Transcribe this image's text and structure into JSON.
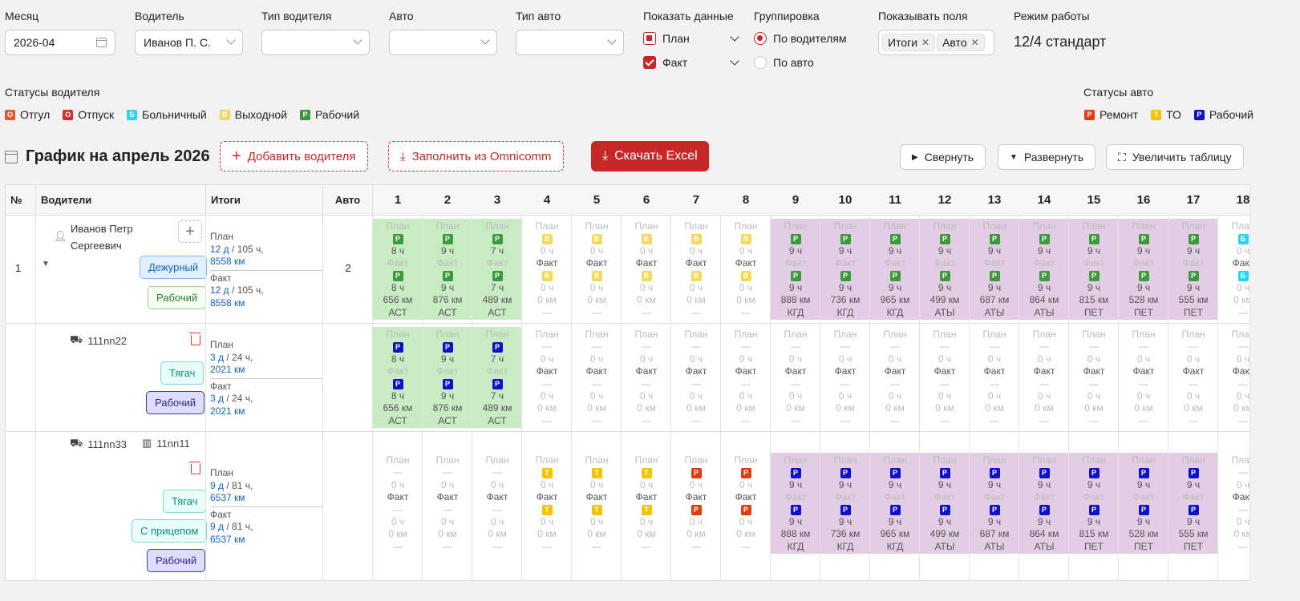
{
  "filters": {
    "month": {
      "label": "Месяц",
      "value": "2026-04"
    },
    "driver": {
      "label": "Водитель",
      "value": "Иванов П. С."
    },
    "driver_type": {
      "label": "Тип водителя",
      "value": ""
    },
    "auto": {
      "label": "Авто",
      "value": ""
    },
    "auto_type": {
      "label": "Тип авто",
      "value": ""
    },
    "show_data": {
      "label": "Показать данные",
      "plan": "План",
      "fact": "Факт"
    },
    "grouping": {
      "label": "Группировка",
      "by_drivers": "По водителям",
      "by_auto": "По авто"
    },
    "show_fields": {
      "label": "Показывать поля",
      "tags": [
        "Итоги",
        "Авто"
      ]
    },
    "work_mode": {
      "label": "Режим работы",
      "value": "12/4 стандарт"
    }
  },
  "driver_statuses": {
    "label": "Статусы водителя",
    "items": [
      {
        "letter": "О",
        "text": "Отгул",
        "color": "#e8542f"
      },
      {
        "letter": "О",
        "text": "Отпуск",
        "color": "#d32f2f"
      },
      {
        "letter": "Б",
        "text": "Больничный",
        "color": "#2ad4f5"
      },
      {
        "letter": "В",
        "text": "Выходной",
        "color": "#f5d95c"
      },
      {
        "letter": "Р",
        "text": "Рабочий",
        "color": "#3c9a3c"
      }
    ]
  },
  "auto_statuses": {
    "label": "Статусы авто",
    "items": [
      {
        "letter": "Р",
        "text": "Ремонт",
        "color": "#e53a0f"
      },
      {
        "letter": "Т",
        "text": "ТО",
        "color": "#f4c400"
      },
      {
        "letter": "Р",
        "text": "Рабочий",
        "color": "#1010c8"
      }
    ]
  },
  "toolbar": {
    "title": "График на апрель 2026",
    "add_driver": "Добавить водителя",
    "fill_omnicomm": "Заполнить из Omnicomm",
    "download_excel": "Скачать Excel",
    "collapse": "Свернуть",
    "expand": "Развернуть",
    "enlarge": "Увеличить таблицу"
  },
  "table": {
    "headers": {
      "num": "№",
      "drivers": "Водители",
      "totals": "Итоги",
      "auto": "Авто"
    },
    "days": [
      "1",
      "2",
      "3",
      "4",
      "5",
      "6",
      "7",
      "8",
      "9",
      "10",
      "11",
      "12",
      "13",
      "14",
      "15",
      "16",
      "17",
      "18"
    ],
    "labels": {
      "plan": "План",
      "fact": "Факт",
      "dash": "—"
    },
    "rows": [
      {
        "num": "1",
        "name": "Иванов Петр Сергеевич",
        "pills": [
          "Дежурный",
          "Рабочий"
        ],
        "totals": {
          "plan_label": "План",
          "plan_days": "12 д",
          "plan_hours": "/ 105 ч,",
          "plan_km": "8558 км",
          "fact_label": "Факт",
          "fact_days": "12 д",
          "fact_hours": "/ 105 ч,",
          "fact_km": "8558 км"
        },
        "auto_count": "2",
        "cells": [
          {
            "bg": "green",
            "pb": "Р",
            "pc": "#3c9a3c",
            "ph": "8 ч",
            "fb": "Р",
            "fc": "#3c9a3c",
            "fh": "8 ч",
            "km": "656 км",
            "loc": "АСТ"
          },
          {
            "bg": "green",
            "pb": "Р",
            "pc": "#3c9a3c",
            "ph": "9 ч",
            "fb": "Р",
            "fc": "#3c9a3c",
            "fh": "9 ч",
            "km": "876 км",
            "loc": "АСТ"
          },
          {
            "bg": "green",
            "pb": "Р",
            "pc": "#3c9a3c",
            "ph": "7 ч",
            "fb": "Р",
            "fc": "#3c9a3c",
            "fh": "7 ч",
            "km": "489 км",
            "loc": "АСТ"
          },
          {
            "bg": "",
            "pb": "В",
            "pc": "#f5d95c",
            "ph": "0 ч",
            "fb": "В",
            "fc": "#f5d95c",
            "fh": "0 ч",
            "km": "0 км",
            "loc": "—",
            "mute": true
          },
          {
            "bg": "",
            "pb": "В",
            "pc": "#f5d95c",
            "ph": "0 ч",
            "fb": "В",
            "fc": "#f5d95c",
            "fh": "0 ч",
            "km": "0 км",
            "loc": "—",
            "mute": true
          },
          {
            "bg": "",
            "pb": "В",
            "pc": "#f5d95c",
            "ph": "0 ч",
            "fb": "В",
            "fc": "#f5d95c",
            "fh": "0 ч",
            "km": "0 км",
            "loc": "—",
            "mute": true
          },
          {
            "bg": "",
            "pb": "В",
            "pc": "#f5d95c",
            "ph": "0 ч",
            "fb": "В",
            "fc": "#f5d95c",
            "fh": "0 ч",
            "km": "0 км",
            "loc": "—",
            "mute": true
          },
          {
            "bg": "",
            "pb": "В",
            "pc": "#f5d95c",
            "ph": "0 ч",
            "fb": "В",
            "fc": "#f5d95c",
            "fh": "0 ч",
            "km": "0 км",
            "loc": "—",
            "mute": true
          },
          {
            "bg": "purple",
            "pb": "Р",
            "pc": "#3c9a3c",
            "ph": "9 ч",
            "fb": "Р",
            "fc": "#3c9a3c",
            "fh": "9 ч",
            "km": "888 км",
            "loc": "КГД"
          },
          {
            "bg": "purple",
            "pb": "Р",
            "pc": "#3c9a3c",
            "ph": "9 ч",
            "fb": "Р",
            "fc": "#3c9a3c",
            "fh": "9 ч",
            "km": "736 км",
            "loc": "КГД"
          },
          {
            "bg": "purple",
            "pb": "Р",
            "pc": "#3c9a3c",
            "ph": "9 ч",
            "fb": "Р",
            "fc": "#3c9a3c",
            "fh": "9 ч",
            "km": "965 км",
            "loc": "КГД"
          },
          {
            "bg": "purple",
            "pb": "Р",
            "pc": "#3c9a3c",
            "ph": "9 ч",
            "fb": "Р",
            "fc": "#3c9a3c",
            "fh": "9 ч",
            "km": "499 км",
            "loc": "АТЫ"
          },
          {
            "bg": "purple",
            "pb": "Р",
            "pc": "#3c9a3c",
            "ph": "9 ч",
            "fb": "Р",
            "fc": "#3c9a3c",
            "fh": "9 ч",
            "km": "687 км",
            "loc": "АТЫ"
          },
          {
            "bg": "purple",
            "pb": "Р",
            "pc": "#3c9a3c",
            "ph": "9 ч",
            "fb": "Р",
            "fc": "#3c9a3c",
            "fh": "9 ч",
            "km": "864 км",
            "loc": "АТЫ"
          },
          {
            "bg": "purple",
            "pb": "Р",
            "pc": "#3c9a3c",
            "ph": "9 ч",
            "fb": "Р",
            "fc": "#3c9a3c",
            "fh": "9 ч",
            "km": "815 км",
            "loc": "ПЕТ"
          },
          {
            "bg": "purple",
            "pb": "Р",
            "pc": "#3c9a3c",
            "ph": "9 ч",
            "fb": "Р",
            "fc": "#3c9a3c",
            "fh": "9 ч",
            "km": "528 км",
            "loc": "ПЕТ"
          },
          {
            "bg": "purple",
            "pb": "Р",
            "pc": "#3c9a3c",
            "ph": "9 ч",
            "fb": "Р",
            "fc": "#3c9a3c",
            "fh": "9 ч",
            "km": "555 км",
            "loc": "ПЕТ"
          },
          {
            "bg": "",
            "pb": "Б",
            "pc": "#2ad4f5",
            "ph": "0 ч",
            "fb": "Б",
            "fc": "#2ad4f5",
            "fh": "0 ч",
            "km": "0 км",
            "loc": "—",
            "mute": true
          }
        ]
      },
      {
        "num": "",
        "truck": "111nn22",
        "pills": [
          "Тягач",
          "Рабочий"
        ],
        "totals": {
          "plan_label": "План",
          "plan_days": "3 д",
          "plan_hours": "/ 24 ч,",
          "plan_km": "2021 км",
          "fact_label": "Факт",
          "fact_days": "3 д",
          "fact_hours": "/ 24 ч,",
          "fact_km": "2021 км"
        },
        "auto_count": "",
        "cells": [
          {
            "bg": "green",
            "pb": "Р",
            "pc": "#1010c8",
            "ph": "8 ч",
            "fb": "Р",
            "fc": "#1010c8",
            "fh": "8 ч",
            "km": "656 км",
            "loc": "АСТ"
          },
          {
            "bg": "green",
            "pb": "Р",
            "pc": "#1010c8",
            "ph": "9 ч",
            "fb": "Р",
            "fc": "#1010c8",
            "fh": "9 ч",
            "km": "876 км",
            "loc": "АСТ"
          },
          {
            "bg": "green",
            "pb": "Р",
            "pc": "#1010c8",
            "ph": "7 ч",
            "fb": "Р",
            "fc": "#1010c8",
            "fh": "7 ч",
            "km": "489 км",
            "loc": "АСТ"
          }
        ]
      },
      {
        "num": "",
        "truck": "111nn33",
        "trailer": "11nn11",
        "pills": [
          "Тягач",
          "С прицепом",
          "Рабочий"
        ],
        "totals": {
          "plan_label": "План",
          "plan_days": "9 д",
          "plan_hours": "/ 81 ч,",
          "plan_km": "6537 км",
          "fact_label": "Факт",
          "fact_days": "9 д",
          "fact_hours": "/ 81 ч,",
          "fact_km": "6537 км"
        },
        "auto_count": "",
        "cells": [
          {
            "bg": "",
            "pb": "",
            "ph": "0 ч",
            "fb": "",
            "fh": "0 ч",
            "km": "0 км",
            "loc": "—",
            "mute": true
          },
          {
            "bg": "",
            "pb": "",
            "ph": "0 ч",
            "fb": "",
            "fh": "0 ч",
            "km": "0 км",
            "loc": "—",
            "mute": true
          },
          {
            "bg": "",
            "pb": "",
            "ph": "0 ч",
            "fb": "",
            "fh": "0 ч",
            "km": "0 км",
            "loc": "—",
            "mute": true
          },
          {
            "bg": "",
            "pb": "Т",
            "pc": "#f4c400",
            "ph": "0 ч",
            "fb": "Т",
            "fc": "#f4c400",
            "fh": "0 ч",
            "km": "0 км",
            "loc": "—",
            "mute": true
          },
          {
            "bg": "",
            "pb": "Т",
            "pc": "#f4c400",
            "ph": "0 ч",
            "fb": "Т",
            "fc": "#f4c400",
            "fh": "0 ч",
            "km": "0 км",
            "loc": "—",
            "mute": true
          },
          {
            "bg": "",
            "pb": "Т",
            "pc": "#f4c400",
            "ph": "0 ч",
            "fb": "Т",
            "fc": "#f4c400",
            "fh": "0 ч",
            "km": "0 км",
            "loc": "—",
            "mute": true
          },
          {
            "bg": "",
            "pb": "Р",
            "pc": "#e53a0f",
            "ph": "0 ч",
            "fb": "Р",
            "fc": "#e53a0f",
            "fh": "0 ч",
            "km": "0 км",
            "loc": "—",
            "mute": true
          },
          {
            "bg": "",
            "pb": "Р",
            "pc": "#e53a0f",
            "ph": "0 ч",
            "fb": "Р",
            "fc": "#e53a0f",
            "fh": "0 ч",
            "km": "0 км",
            "loc": "—",
            "mute": true
          },
          {
            "bg": "purple",
            "pb": "Р",
            "pc": "#1010c8",
            "ph": "9 ч",
            "fb": "Р",
            "fc": "#1010c8",
            "fh": "9 ч",
            "km": "888 км",
            "loc": "КГД"
          },
          {
            "bg": "purple",
            "pb": "Р",
            "pc": "#1010c8",
            "ph": "9 ч",
            "fb": "Р",
            "fc": "#1010c8",
            "fh": "9 ч",
            "km": "736 км",
            "loc": "КГД"
          },
          {
            "bg": "purple",
            "pb": "Р",
            "pc": "#1010c8",
            "ph": "9 ч",
            "fb": "Р",
            "fc": "#1010c8",
            "fh": "9 ч",
            "km": "965 км",
            "loc": "КГД"
          },
          {
            "bg": "purple",
            "pb": "Р",
            "pc": "#1010c8",
            "ph": "9 ч",
            "fb": "Р",
            "fc": "#1010c8",
            "fh": "9 ч",
            "km": "499 км",
            "loc": "АТЫ"
          },
          {
            "bg": "purple",
            "pb": "Р",
            "pc": "#1010c8",
            "ph": "9 ч",
            "fb": "Р",
            "fc": "#1010c8",
            "fh": "9 ч",
            "km": "687 км",
            "loc": "АТЫ"
          },
          {
            "bg": "purple",
            "pb": "Р",
            "pc": "#1010c8",
            "ph": "9 ч",
            "fb": "Р",
            "fc": "#1010c8",
            "fh": "9 ч",
            "km": "864 км",
            "loc": "АТЫ"
          },
          {
            "bg": "purple",
            "pb": "Р",
            "pc": "#1010c8",
            "ph": "9 ч",
            "fb": "Р",
            "fc": "#1010c8",
            "fh": "9 ч",
            "km": "815 км",
            "loc": "ПЕТ"
          },
          {
            "bg": "purple",
            "pb": "Р",
            "pc": "#1010c8",
            "ph": "9 ч",
            "fb": "Р",
            "fc": "#1010c8",
            "fh": "9 ч",
            "km": "528 км",
            "loc": "ПЕТ"
          },
          {
            "bg": "purple",
            "pb": "Р",
            "pc": "#1010c8",
            "ph": "9 ч",
            "fb": "Р",
            "fc": "#1010c8",
            "fh": "9 ч",
            "km": "555 км",
            "loc": "ПЕТ"
          },
          {
            "bg": "",
            "pb": "",
            "ph": "0 ч",
            "fb": "",
            "fh": "0 ч",
            "km": "0 км",
            "loc": "—",
            "mute": true
          }
        ]
      }
    ]
  }
}
